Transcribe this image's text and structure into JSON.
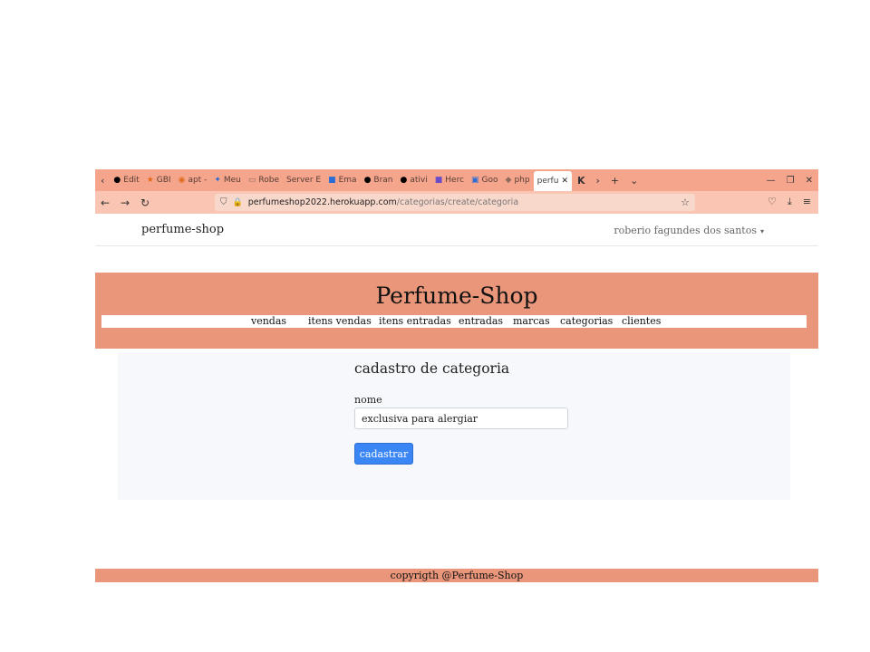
{
  "browser": {
    "tabs": [
      {
        "icon": "github-icon",
        "label": "Edit"
      },
      {
        "icon": "gbi-icon",
        "label": "GBI"
      },
      {
        "icon": "apt-icon",
        "label": "apt -"
      },
      {
        "icon": "meu-icon",
        "label": "Meu"
      },
      {
        "icon": "robe-icon",
        "label": "Robe"
      },
      {
        "icon": "server-icon",
        "label": "Server E"
      },
      {
        "icon": "outlook-icon",
        "label": "Ema"
      },
      {
        "icon": "github-icon",
        "label": "Bran"
      },
      {
        "icon": "github-icon",
        "label": "ativi"
      },
      {
        "icon": "heroku-icon",
        "label": "Herc"
      },
      {
        "icon": "translate-icon",
        "label": "Goo"
      },
      {
        "icon": "php-icon",
        "label": "php"
      },
      {
        "icon": "page-icon",
        "label": "perfu"
      }
    ],
    "url_host": "perfumeshop2022.herokuapp.com",
    "url_path": "/categorias/create/categoria"
  },
  "app": {
    "brand": "perfume-shop",
    "user": "roberio fagundes dos santos"
  },
  "hero": {
    "title": "Perfume-Shop",
    "menu": [
      "vendas",
      "itens vendas",
      "itens entradas",
      "entradas",
      "marcas",
      "categorias",
      "clientes"
    ]
  },
  "form": {
    "title": "cadastro de categoria",
    "name_label": "nome",
    "name_value": "exclusiva para alergiar",
    "submit_label": "cadastrar"
  },
  "footer": {
    "text": "copyrigth @Perfume-Shop"
  },
  "colors": {
    "tabstrip": "#f6a58d",
    "hero": "#e9967a",
    "button": "#3b86f5"
  }
}
